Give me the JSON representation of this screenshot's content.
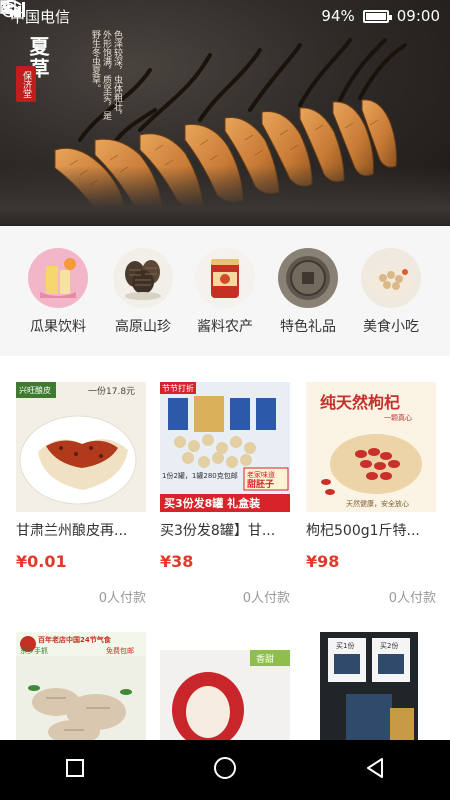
{
  "status_bar": {
    "carrier": "中国电信",
    "battery": "94%",
    "time": "09:00",
    "icons": [
      "usb-icon",
      "image-icon",
      "alarm-icon",
      "wifi-icon",
      "signal-3g-icon",
      "battery-icon"
    ]
  },
  "banner": {
    "brand": "夏草",
    "stamp": "保济堂",
    "tagline": "色泽较深，虫体粗壮，外形饱满，质坚实，是野生冬虫夏草。"
  },
  "categories": [
    {
      "label": "瓜果饮料",
      "icon": "fruit-drink-icon"
    },
    {
      "label": "高原山珍",
      "icon": "mushroom-icon"
    },
    {
      "label": "酱料农产",
      "icon": "sauce-jar-icon"
    },
    {
      "label": "特色礼品",
      "icon": "gift-coin-icon"
    },
    {
      "label": "美食小吃",
      "icon": "snack-icon"
    }
  ],
  "products": [
    {
      "title": "甘肃兰州酿皮再...",
      "price": "¥0.01",
      "sold": "0人付款",
      "image": {
        "badge": "一份17.8元",
        "brand": "兴旺酿皮"
      }
    },
    {
      "title": "买3份发8罐】甘...",
      "price": "¥38",
      "sold": "0人付款",
      "image": {
        "top_text": "节节打折",
        "promo_line": "1份2罐，1罐280克包邮",
        "name": "老家味道",
        "name2": "甜胚子",
        "banner": "买3份发8罐 礼盒装"
      }
    },
    {
      "title": "枸杞500g1斤特...",
      "price": "¥98",
      "sold": "0人付款",
      "image": {
        "headline": "纯天然枸杞",
        "sub": "一颗真心",
        "foot": "天然健康，安全放心"
      }
    },
    {
      "title": "",
      "price": "",
      "sold": "",
      "image": {
        "headline": "百年老店中国24节气食",
        "sub": "东乡手抓",
        "sub2": "免费包邮"
      }
    },
    {
      "title": "",
      "price": "",
      "sold": "",
      "image": {
        "badge": "香甜"
      }
    },
    {
      "title": "",
      "price": "",
      "sold": "",
      "image": {
        "left": "买1份",
        "right": "买2份"
      }
    }
  ],
  "nav_bar": [
    "recent-apps-icon",
    "home-icon",
    "back-icon"
  ]
}
